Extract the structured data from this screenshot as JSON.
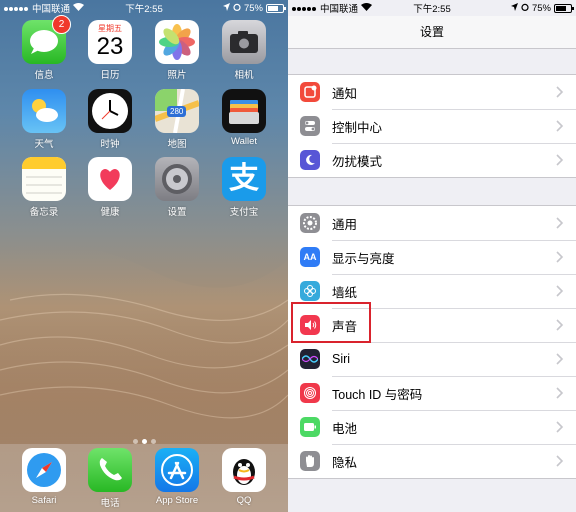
{
  "home": {
    "status": {
      "carrier": "中国联通",
      "time": "下午2:55",
      "battery": "75%"
    },
    "apps": [
      {
        "id": "messages",
        "label": "信息",
        "badge": "2"
      },
      {
        "id": "calendar",
        "label": "日历",
        "weekday": "星期五",
        "day": "23"
      },
      {
        "id": "photos",
        "label": "照片"
      },
      {
        "id": "camera",
        "label": "相机"
      },
      {
        "id": "weather",
        "label": "天气"
      },
      {
        "id": "clock",
        "label": "时钟"
      },
      {
        "id": "maps",
        "label": "地图",
        "road_number": "280"
      },
      {
        "id": "wallet",
        "label": "Wallet"
      },
      {
        "id": "notes",
        "label": "备忘录"
      },
      {
        "id": "health",
        "label": "健康"
      },
      {
        "id": "settings",
        "label": "设置"
      },
      {
        "id": "alipay",
        "label": "支付宝",
        "glyph": "支"
      }
    ],
    "dock": [
      {
        "id": "safari",
        "label": "Safari"
      },
      {
        "id": "phone",
        "label": "电话"
      },
      {
        "id": "appstore",
        "label": "App Store"
      },
      {
        "id": "qq",
        "label": "QQ"
      }
    ],
    "pages": {
      "count": 3,
      "current": 2
    }
  },
  "settings": {
    "status": {
      "carrier": "中国联通",
      "time": "下午2:55",
      "battery": "75%"
    },
    "title": "设置",
    "groups": [
      [
        {
          "id": "notifications",
          "label": "通知",
          "color": "#f24a3b"
        },
        {
          "id": "control-center",
          "label": "控制中心",
          "color": "#8e8e93"
        },
        {
          "id": "do-not-disturb",
          "label": "勿扰模式",
          "color": "#5856d6"
        }
      ],
      [
        {
          "id": "general",
          "label": "通用",
          "color": "#8e8e93"
        },
        {
          "id": "display-brightness",
          "label": "显示与亮度",
          "color": "#2f7cf6",
          "icon_text": "AA"
        },
        {
          "id": "wallpaper",
          "label": "墙纸",
          "color": "#36aadc"
        },
        {
          "id": "sounds",
          "label": "声音",
          "color": "#f2384f"
        },
        {
          "id": "siri",
          "label": "Siri",
          "color": "#222233"
        },
        {
          "id": "touch-id",
          "label": "Touch ID 与密码",
          "color": "#f0384a"
        },
        {
          "id": "battery",
          "label": "电池",
          "color": "#4cd964"
        },
        {
          "id": "privacy",
          "label": "隐私",
          "color": "#8e8e93"
        }
      ]
    ]
  }
}
